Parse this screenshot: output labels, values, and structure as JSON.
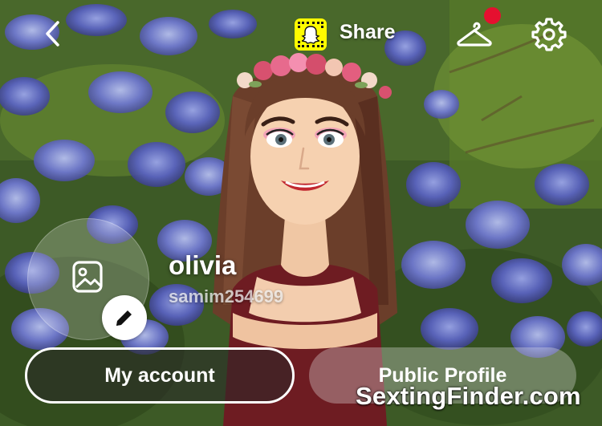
{
  "header": {
    "share_label": "Share",
    "back_icon": "chevron-left-icon",
    "snapcode_icon": "snapcode-icon",
    "outfit_icon": "hanger-icon",
    "settings_icon": "gear-icon",
    "notification_dot": true
  },
  "profile": {
    "display_name": "olivia",
    "username": "samim254699",
    "photo_icon": "image-icon",
    "edit_icon": "pencil-icon"
  },
  "buttons": {
    "my_account": "My account",
    "public_profile": "Public Profile"
  },
  "watermark": "SextingFinder.com",
  "colors": {
    "accent_yellow": "#fffc00",
    "notification_red": "#e5102f"
  }
}
